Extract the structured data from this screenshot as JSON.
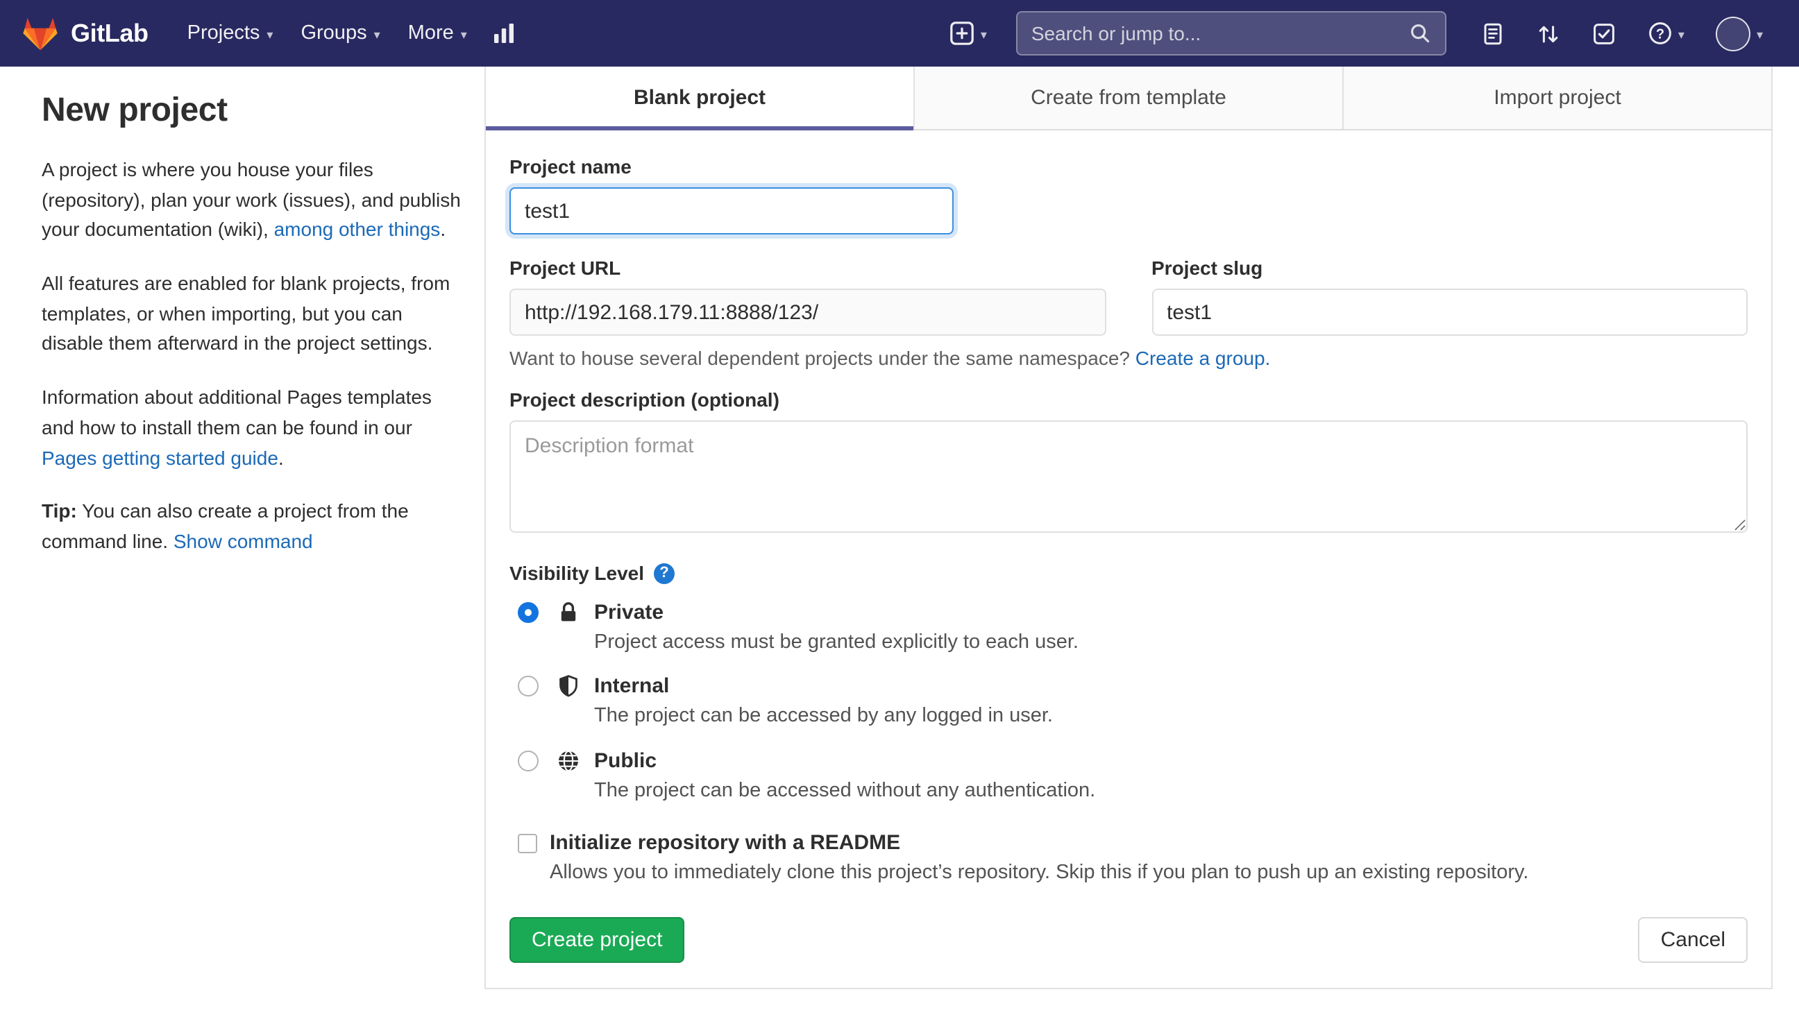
{
  "navbar": {
    "brand": "GitLab",
    "menus": [
      {
        "label": "Projects"
      },
      {
        "label": "Groups"
      },
      {
        "label": "More"
      }
    ],
    "search": {
      "placeholder": "Search or jump to..."
    },
    "right_icons": [
      "new-menu",
      "issues",
      "merge-requests",
      "todos",
      "help",
      "user-avatar"
    ]
  },
  "sidebar": {
    "title": "New project",
    "p1": {
      "before": "A project is where you house your files (repository), plan your work (issues), and publish your documentation (wiki), ",
      "link": "among other things",
      "after": "."
    },
    "p2": "All features are enabled for blank projects, from templates, or when importing, but you can disable them afterward in the project settings.",
    "p3": {
      "before": "Information about additional Pages templates and how to install them can be found in our ",
      "link": "Pages getting started guide",
      "after": "."
    },
    "tip": {
      "label": "Tip:",
      "text": " You can also create a project from the command line. ",
      "link": "Show command"
    }
  },
  "tabs": [
    {
      "label": "Blank project",
      "active": true
    },
    {
      "label": "Create from template",
      "active": false
    },
    {
      "label": "Import project",
      "active": false
    }
  ],
  "form": {
    "project_name": {
      "label": "Project name",
      "value": "test1"
    },
    "project_url": {
      "label": "Project URL",
      "value": "http://192.168.179.11:8888/123/"
    },
    "project_slug": {
      "label": "Project slug",
      "value": "test1"
    },
    "namespace_hint": {
      "text": "Want to house several dependent projects under the same namespace? ",
      "link": "Create a group."
    },
    "description": {
      "label": "Project description (optional)",
      "placeholder": "Description format"
    },
    "visibility": {
      "label": "Visibility Level",
      "options": [
        {
          "name": "Private",
          "description": "Project access must be granted explicitly to each user.",
          "icon": "lock-icon",
          "selected": true
        },
        {
          "name": "Internal",
          "description": "The project can be accessed by any logged in user.",
          "icon": "shield-icon",
          "selected": false
        },
        {
          "name": "Public",
          "description": "The project can be accessed without any authentication.",
          "icon": "globe-icon",
          "selected": false
        }
      ]
    },
    "readme": {
      "label": "Initialize repository with a README",
      "description": "Allows you to immediately clone this project’s repository. Skip this if you plan to push up an existing repository.",
      "checked": false
    },
    "actions": {
      "create": "Create project",
      "cancel": "Cancel"
    }
  },
  "colors": {
    "navbar_bg": "#292961",
    "link_blue": "#1b69b6",
    "primary_green": "#1aaa55",
    "tab_indicator": "#5d5b9e",
    "focus_blue": "#3b8ee0",
    "radio_blue": "#1374e0"
  }
}
